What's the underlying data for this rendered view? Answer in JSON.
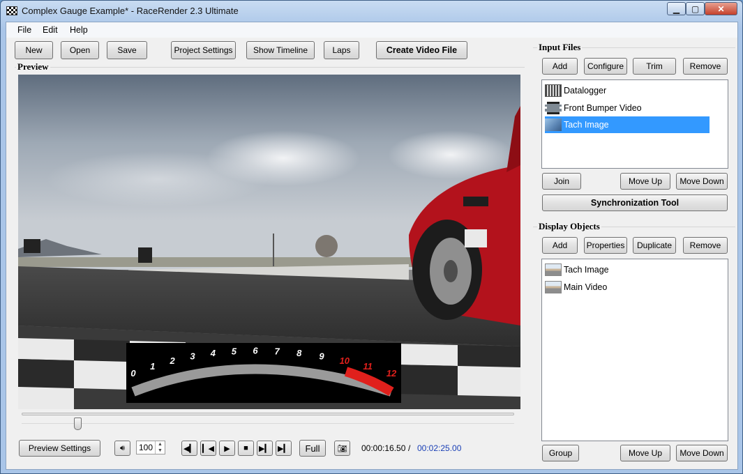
{
  "window": {
    "title": "Complex Gauge Example* - RaceRender 2.3 Ultimate",
    "controls": [
      "minimize",
      "maximize",
      "close"
    ]
  },
  "menu": [
    {
      "label": "File"
    },
    {
      "label": "Edit"
    },
    {
      "label": "Help"
    }
  ],
  "toolbar": {
    "new": "New",
    "open": "Open",
    "save": "Save",
    "project_settings": "Project Settings",
    "show_timeline": "Show Timeline",
    "laps": "Laps",
    "create_video": "Create Video File"
  },
  "preview": {
    "label": "Preview",
    "gauge_ticks": [
      "0",
      "1",
      "2",
      "3",
      "4",
      "5",
      "6",
      "7",
      "8",
      "9",
      "10",
      "11",
      "12"
    ],
    "redline_from": 10
  },
  "input_files": {
    "label": "Input Files",
    "buttons": {
      "add": "Add",
      "configure": "Configure",
      "trim": "Trim",
      "remove": "Remove"
    },
    "items": [
      {
        "label": "Datalogger",
        "icon": "datalogger-icon"
      },
      {
        "label": "Front Bumper Video",
        "icon": "video-file-icon"
      },
      {
        "label": "Tach Image",
        "icon": "image-file-icon",
        "selected": true
      }
    ],
    "bottom_buttons": {
      "join": "Join",
      "move_up": "Move Up",
      "move_down": "Move Down"
    },
    "sync_tool": "Synchronization Tool"
  },
  "display_objects": {
    "label": "Display Objects",
    "buttons": {
      "add": "Add",
      "properties": "Properties",
      "duplicate": "Duplicate",
      "remove": "Remove"
    },
    "items": [
      {
        "label": "Tach Image",
        "icon": "display-object-icon"
      },
      {
        "label": "Main Video",
        "icon": "display-object-icon"
      }
    ],
    "bottom_buttons": {
      "group": "Group",
      "move_up": "Move Up",
      "move_down": "Move Down"
    }
  },
  "playback": {
    "preview_settings": "Preview Settings",
    "volume": "100",
    "full": "Full",
    "current_time": "00:00:16.50",
    "separator": "/",
    "total_time": "00:02:25.00",
    "position_fraction": 0.114
  },
  "colors": {
    "selection": "#3399ff",
    "total_time": "#1a3fb5",
    "car_red": "#b3121c",
    "redline": "#e0201c"
  }
}
